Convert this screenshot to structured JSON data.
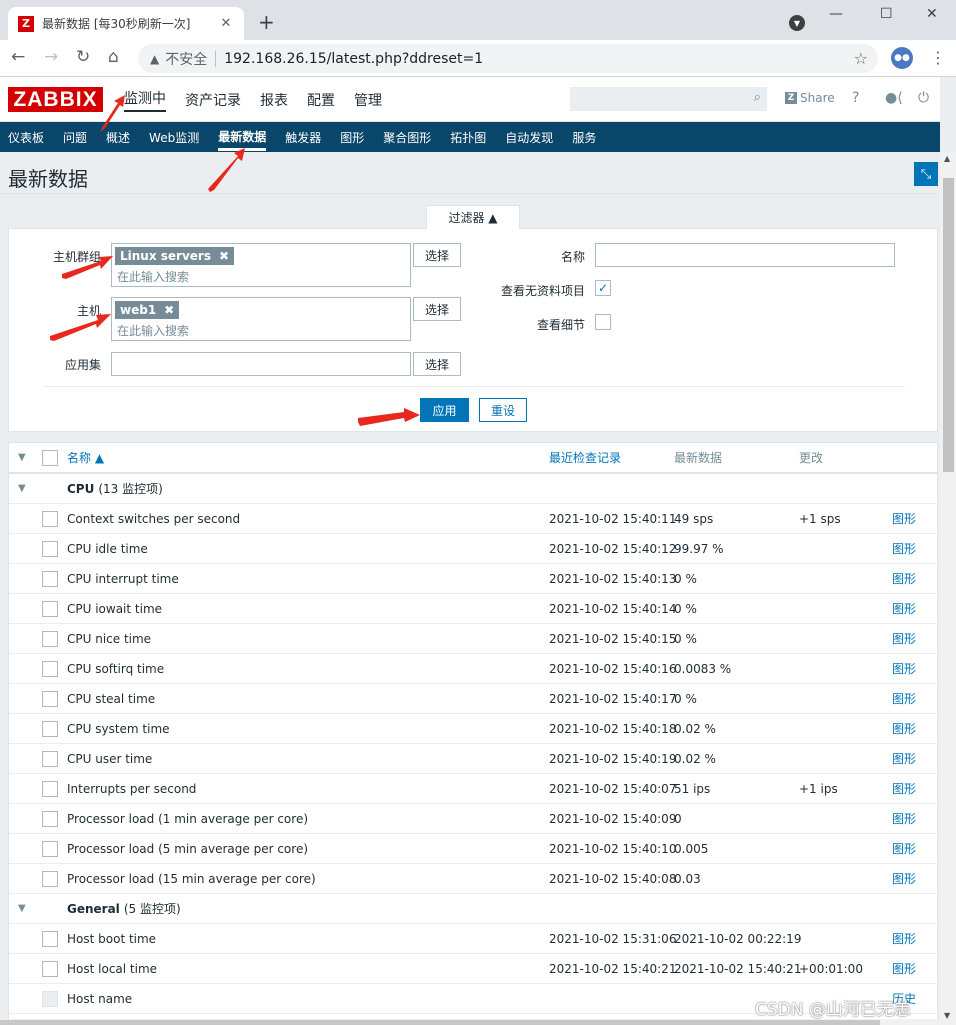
{
  "browser": {
    "tab_title": "最新数据 [每30秒刷新一次]",
    "favicon_letter": "Z",
    "insecure_label": "不安全",
    "url": "192.168.26.15/latest.php?ddreset=1"
  },
  "header": {
    "logo": "ZABBIX",
    "menu": [
      "监测中",
      "资产记录",
      "报表",
      "配置",
      "管理"
    ],
    "share_label": "Share",
    "help": "?"
  },
  "subnav": [
    "仪表板",
    "问题",
    "概述",
    "Web监测",
    "最新数据",
    "触发器",
    "图形",
    "聚合图形",
    "拓扑图",
    "自动发现",
    "服务"
  ],
  "page": {
    "title": "最新数据"
  },
  "filter": {
    "tab_label": "过滤器 ▲",
    "host_groups_label": "主机群组",
    "host_groups_chip": "Linux servers",
    "hosts_label": "主机",
    "hosts_chip": "web1",
    "placeholder": "在此输入搜索",
    "apps_label": "应用集",
    "select_label": "选择",
    "name_label": "名称",
    "show_without_data_label": "查看无资料项目",
    "show_without_data_checked": "✓",
    "show_details_label": "查看细节",
    "apply_label": "应用",
    "reset_label": "重设"
  },
  "table": {
    "headers": {
      "name": "名称 ▲",
      "last_check": "最近检查记录",
      "last_value": "最新数据",
      "change": "更改"
    },
    "groups": [
      {
        "name": "CPU",
        "count": "(13 监控项)",
        "items": [
          {
            "name": "Context switches per second",
            "last_check": "2021-10-02 15:40:11",
            "last_value": "49 sps",
            "change": "+1 sps",
            "action": "图形"
          },
          {
            "name": "CPU idle time",
            "last_check": "2021-10-02 15:40:12",
            "last_value": "99.97 %",
            "change": "",
            "action": "图形"
          },
          {
            "name": "CPU interrupt time",
            "last_check": "2021-10-02 15:40:13",
            "last_value": "0 %",
            "change": "",
            "action": "图形"
          },
          {
            "name": "CPU iowait time",
            "last_check": "2021-10-02 15:40:14",
            "last_value": "0 %",
            "change": "",
            "action": "图形"
          },
          {
            "name": "CPU nice time",
            "last_check": "2021-10-02 15:40:15",
            "last_value": "0 %",
            "change": "",
            "action": "图形"
          },
          {
            "name": "CPU softirq time",
            "last_check": "2021-10-02 15:40:16",
            "last_value": "0.0083 %",
            "change": "",
            "action": "图形"
          },
          {
            "name": "CPU steal time",
            "last_check": "2021-10-02 15:40:17",
            "last_value": "0 %",
            "change": "",
            "action": "图形"
          },
          {
            "name": "CPU system time",
            "last_check": "2021-10-02 15:40:18",
            "last_value": "0.02 %",
            "change": "",
            "action": "图形"
          },
          {
            "name": "CPU user time",
            "last_check": "2021-10-02 15:40:19",
            "last_value": "0.02 %",
            "change": "",
            "action": "图形"
          },
          {
            "name": "Interrupts per second",
            "last_check": "2021-10-02 15:40:07",
            "last_value": "51 ips",
            "change": "+1 ips",
            "action": "图形"
          },
          {
            "name": "Processor load (1 min average per core)",
            "last_check": "2021-10-02 15:40:09",
            "last_value": "0",
            "change": "",
            "action": "图形"
          },
          {
            "name": "Processor load (5 min average per core)",
            "last_check": "2021-10-02 15:40:10",
            "last_value": "0.005",
            "change": "",
            "action": "图形"
          },
          {
            "name": "Processor load (15 min average per core)",
            "last_check": "2021-10-02 15:40:08",
            "last_value": "0.03",
            "change": "",
            "action": "图形"
          }
        ]
      },
      {
        "name": "General",
        "count": "(5 监控项)",
        "items": [
          {
            "name": "Host boot time",
            "last_check": "2021-10-02 15:31:06",
            "last_value": "2021-10-02 00:22:19",
            "change": "",
            "action": "图形"
          },
          {
            "name": "Host local time",
            "last_check": "2021-10-02 15:40:21",
            "last_value": "2021-10-02 15:40:21",
            "change": "+00:01:00",
            "action": "图形"
          },
          {
            "name": "Host name",
            "last_check": "",
            "last_value": "",
            "change": "",
            "action": "历史",
            "disabled": true
          }
        ]
      }
    ]
  },
  "watermark": "CSDN @山河已无恙",
  "colors": {
    "zabbix_red": "#d40000",
    "nav_blue": "#0a466a",
    "link_blue": "#0275b8",
    "annotation_red": "#e8281e"
  }
}
